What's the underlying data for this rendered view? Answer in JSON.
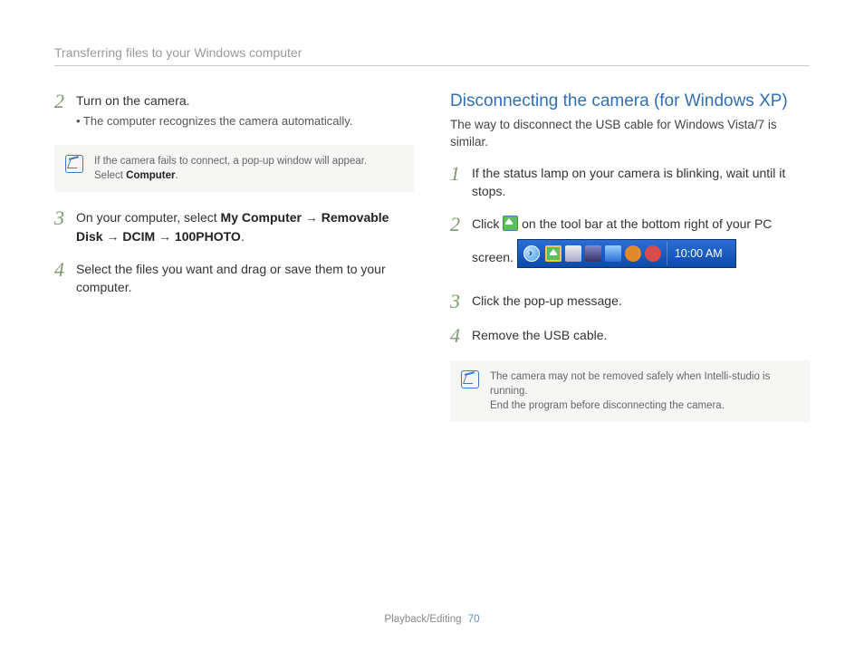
{
  "header": {
    "title": "Transferring files to your Windows computer"
  },
  "left": {
    "step2": {
      "num": "2",
      "text": "Turn on the camera.",
      "bullet": "•  The computer recognizes the camera automatically."
    },
    "note1": {
      "line1": "If the camera fails to connect, a pop-up window will appear.",
      "line2_pre": "Select ",
      "line2_bold": "Computer",
      "line2_post": "."
    },
    "step3": {
      "num": "3",
      "pre": "On your computer, select ",
      "b1": "My Computer",
      "arr1": " → ",
      "b2": "Removable Disk",
      "arr2": " → ",
      "b3": "DCIM",
      "arr3": " → ",
      "b4": "100PHOTO",
      "post": "."
    },
    "step4": {
      "num": "4",
      "text": "Select the files you want and drag or save them to your computer."
    }
  },
  "right": {
    "title": "Disconnecting the camera (for Windows XP)",
    "sub": "The way to disconnect the USB cable for Windows Vista/7 is similar.",
    "step1": {
      "num": "1",
      "text": "If the status lamp on your camera is blinking, wait until it stops."
    },
    "step2": {
      "num": "2",
      "pre": "Click ",
      "post": " on the tool bar at the bottom right of your PC screen."
    },
    "taskbar": {
      "time": "10:00 AM"
    },
    "step3": {
      "num": "3",
      "text": "Click the pop-up message."
    },
    "step4": {
      "num": "4",
      "text": "Remove the USB cable."
    },
    "note2": {
      "line1": "The camera may not be removed safely when Intelli-studio is running.",
      "line2": "End the program before disconnecting the camera."
    }
  },
  "footer": {
    "section": "Playback/Editing",
    "page": "70"
  }
}
